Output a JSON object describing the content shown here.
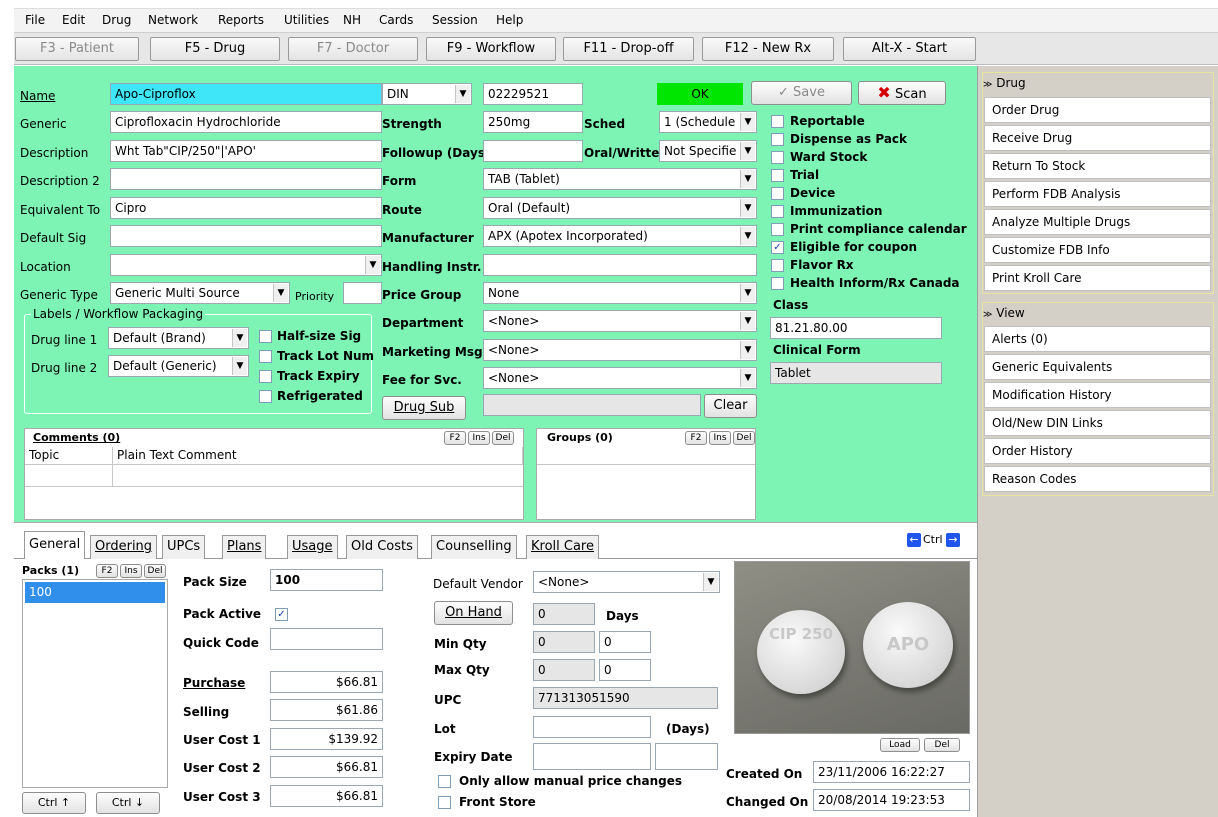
{
  "menu": [
    "File",
    "Edit",
    "Drug",
    "Network",
    "Reports",
    "Utilities",
    "NH",
    "Cards",
    "Session",
    "Help"
  ],
  "fkeys": [
    "F3 - Patient",
    "F5 - Drug",
    "F7 - Doctor",
    "F9 - Workflow",
    "F11 - Drop-off",
    "F12 - New Rx",
    "Alt-X - Start"
  ],
  "form": {
    "name_label": "Name",
    "name": "Apo-Ciproflox",
    "generic_label": "Generic",
    "generic": "Ciprofloxacin Hydrochloride",
    "description_label": "Description",
    "description": "Wht Tab\"CIP/250\"|'APO'",
    "description2_label": "Description 2",
    "description2": "",
    "equivalent_label": "Equivalent To",
    "equivalent": "Cipro",
    "default_sig_label": "Default Sig",
    "default_sig": "",
    "location_label": "Location",
    "location": "",
    "generic_type_label": "Generic Type",
    "generic_type": "Generic Multi Source",
    "priority_label": "Priority",
    "priority": "",
    "id_type": "DIN",
    "din": "02229521",
    "status": "OK",
    "save_label": "Save",
    "scan_label": "Scan",
    "strength_label": "Strength",
    "strength": "250mg",
    "sched_label": "Sched",
    "sched": "1 (Schedule",
    "followup_label": "Followup (Days)",
    "followup": "",
    "oral_label": "Oral/Written",
    "oral": "Not Specifie",
    "form_label": "Form",
    "form_value": "TAB (Tablet)",
    "route_label": "Route",
    "route": "Oral (Default)",
    "manufacturer_label": "Manufacturer",
    "manufacturer": "APX (Apotex Incorporated)",
    "handling_label": "Handling Instr.",
    "handling": "",
    "price_group_label": "Price Group",
    "price_group": "None",
    "department_label": "Department",
    "department": "<None>",
    "marketing_label": "Marketing Msg",
    "marketing": "<None>",
    "fee_label": "Fee for Svc.",
    "fee": "<None>",
    "drug_sub_label": "Drug Sub",
    "drug_sub_value": "",
    "clear_label": "Clear",
    "labels_group_title": "Labels / Workflow Packaging",
    "drug_line1_label": "Drug line 1",
    "drug_line1": "Default (Brand)",
    "drug_line2_label": "Drug line 2",
    "drug_line2": "Default (Generic)",
    "pack_checks": [
      {
        "label": "Half-size Sig",
        "checked": false
      },
      {
        "label": "Track Lot Num",
        "checked": false
      },
      {
        "label": "Track Expiry",
        "checked": false
      },
      {
        "label": "Refrigerated",
        "checked": false
      }
    ],
    "flags": [
      {
        "label": "Reportable",
        "checked": false
      },
      {
        "label": "Dispense as Pack",
        "checked": false
      },
      {
        "label": "Ward Stock",
        "checked": false
      },
      {
        "label": "Trial",
        "checked": false
      },
      {
        "label": "Device",
        "checked": false
      },
      {
        "label": "Immunization",
        "checked": false
      },
      {
        "label": "Print compliance calendar",
        "checked": false
      },
      {
        "label": "Eligible for coupon",
        "checked": true
      },
      {
        "label": "Flavor Rx",
        "checked": false
      },
      {
        "label": "Health Inform/Rx Canada",
        "checked": false
      }
    ],
    "class_label": "Class",
    "class_value": "81.21.80.00",
    "clinical_form_label": "Clinical Form",
    "clinical_form": "Tablet"
  },
  "comments": {
    "title": "Comments (0)",
    "columns": [
      "Topic",
      "Plain Text Comment"
    ],
    "keys": [
      "F2",
      "Ins",
      "Del"
    ]
  },
  "groups": {
    "title": "Groups (0)",
    "keys": [
      "F2",
      "Ins",
      "Del"
    ]
  },
  "tabs": [
    "General",
    "Ordering",
    "UPCs",
    "Plans",
    "Usage",
    "Old Costs",
    "Counselling",
    "Kroll Care"
  ],
  "ctrl_label": "Ctrl",
  "packs": {
    "title": "Packs (1)",
    "keys": [
      "F2",
      "Ins",
      "Del"
    ],
    "items": [
      "100"
    ],
    "ctrl_up": "Ctrl ↑",
    "ctrl_down": "Ctrl ↓"
  },
  "general": {
    "pack_size_label": "Pack Size",
    "pack_size": "100",
    "pack_active_label": "Pack Active",
    "pack_active": true,
    "quick_code_label": "Quick Code",
    "quick_code": "",
    "purchase_label": "Purchase",
    "purchase": "$66.81",
    "selling_label": "Selling",
    "selling": "$61.86",
    "user_cost1_label": "User Cost 1",
    "user_cost1": "$139.92",
    "user_cost2_label": "User Cost 2",
    "user_cost2": "$66.81",
    "user_cost3_label": "User Cost 3",
    "user_cost3": "$66.81",
    "default_vendor_label": "Default Vendor",
    "default_vendor": "<None>",
    "on_hand_label": "On Hand",
    "on_hand": "0",
    "days_label": "Days",
    "min_qty_label": "Min Qty",
    "min_qty": "0",
    "min_qty_days": "0",
    "max_qty_label": "Max Qty",
    "max_qty": "0",
    "max_qty_days": "0",
    "upc_label": "UPC",
    "upc": "771313051590",
    "lot_label": "Lot",
    "lot": "",
    "lot_days_label": "(Days)",
    "expiry_label": "Expiry Date",
    "expiry": "",
    "manual_price_label": "Only allow manual price changes",
    "front_store_label": "Front Store",
    "image_load_label": "Load",
    "image_del_label": "Del",
    "pill_text_1": "CIP 250",
    "pill_text_2": "APO",
    "created_label": "Created On",
    "created": "23/11/2006 16:22:27",
    "changed_label": "Changed On",
    "changed": "20/08/2014 19:23:53"
  },
  "side": {
    "drug_title": "Drug",
    "drug_items": [
      "Order Drug",
      "Receive Drug",
      "Return To Stock",
      "Perform FDB Analysis",
      "Analyze Multiple Drugs",
      "Customize FDB Info",
      "Print Kroll Care"
    ],
    "view_title": "View",
    "view_items": [
      "Alerts (0)",
      "Generic Equivalents",
      "Modification History",
      "Old/New DIN Links",
      "Order History",
      "Reason Codes"
    ]
  },
  "colors": {
    "main_bg": "#7df4b4",
    "name_highlight": "#3ee6f7",
    "ok_status": "#00e600",
    "side_bg": "#d4d0c8",
    "scan_x": "#d40000"
  }
}
